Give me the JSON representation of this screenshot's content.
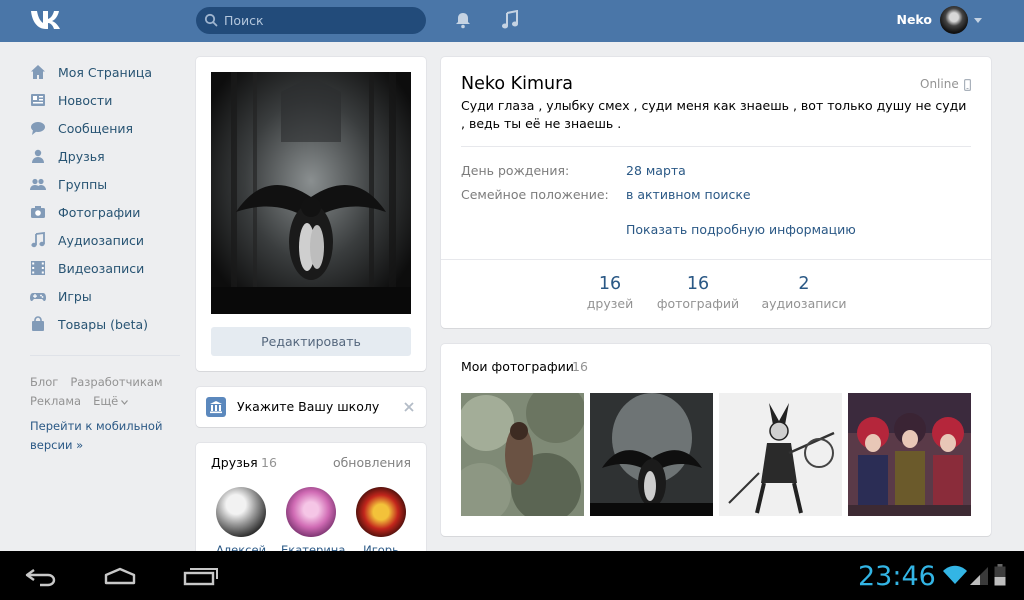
{
  "topbar": {
    "search_placeholder": "Поиск",
    "username": "Neko"
  },
  "nav": {
    "items": [
      {
        "label": "Моя Страница",
        "icon": "home-icon"
      },
      {
        "label": "Новости",
        "icon": "news-icon"
      },
      {
        "label": "Сообщения",
        "icon": "messages-icon"
      },
      {
        "label": "Друзья",
        "icon": "friends-icon"
      },
      {
        "label": "Группы",
        "icon": "groups-icon"
      },
      {
        "label": "Фотографии",
        "icon": "camera-icon"
      },
      {
        "label": "Аудиозаписи",
        "icon": "music-note-icon"
      },
      {
        "label": "Видеозаписи",
        "icon": "film-icon"
      },
      {
        "label": "Игры",
        "icon": "gamepad-icon"
      },
      {
        "label": "Товары (beta)",
        "icon": "shopping-bag-icon"
      }
    ],
    "footer": {
      "blog": "Блог",
      "developers": "Разработчикам",
      "ads": "Реклама",
      "more": "Ещё",
      "mobile": "Перейти к мобильной версии »"
    }
  },
  "avatar_card": {
    "edit_label": "Редактировать"
  },
  "school_card": {
    "text": "Укажите Вашу школу"
  },
  "friends_card": {
    "title": "Друзья",
    "count": "16",
    "updates": "обновления",
    "friends": [
      {
        "name": "Алексей"
      },
      {
        "name": "Екатерина"
      },
      {
        "name": "Игорь"
      }
    ]
  },
  "profile": {
    "name": "Neko Kimura",
    "online": "Online",
    "status": "Суди глаза , улыбку смех , суди меня как знаешь , вот только душу не суди , ведь ты её не знаешь .",
    "birthday_label": "День рождения:",
    "birthday_value": "28 марта",
    "family_label": "Семейное положение:",
    "family_value": "в активном поиске",
    "more_info": "Показать подробную информацию",
    "counters": [
      {
        "num": "16",
        "label": "друзей"
      },
      {
        "num": "16",
        "label": "фотографий"
      },
      {
        "num": "2",
        "label": "аудиозаписи"
      }
    ]
  },
  "photos": {
    "title": "Мои фотографии",
    "count": "16"
  },
  "system_bar": {
    "time": "23:46"
  },
  "colors": {
    "header": "#4a76a8",
    "link": "#2a5885",
    "clock": "#33b5e5"
  }
}
